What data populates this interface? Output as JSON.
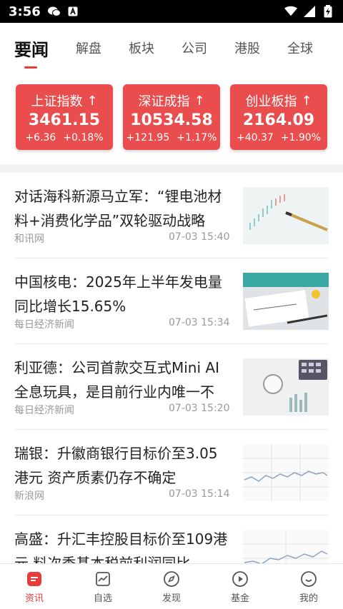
{
  "status": {
    "time": "3:56"
  },
  "tabs": [
    {
      "label": "要闻",
      "active": true
    },
    {
      "label": "解盘"
    },
    {
      "label": "板块"
    },
    {
      "label": "公司"
    },
    {
      "label": "港股"
    },
    {
      "label": "全球"
    }
  ],
  "indices": [
    {
      "name": "上证指数",
      "value": "3461.15",
      "change": "+6.36",
      "pct": "+0.18%"
    },
    {
      "name": "深证成指",
      "value": "10534.58",
      "change": "+121.95",
      "pct": "+1.17%"
    },
    {
      "name": "创业板指",
      "value": "2164.09",
      "change": "+40.37",
      "pct": "+1.90%"
    }
  ],
  "news": [
    {
      "title": "对话海科新源马立军：“锂电池材料+消费化学品”双轮驱动战略",
      "source": "和讯网",
      "time": "07-03 15:40"
    },
    {
      "title": "中国核电：2025年上半年发电量同比增长15.65%",
      "source": "每日经济新闻",
      "time": "07-03 15:34"
    },
    {
      "title": "利亚德：公司首款交互式Mini AI全息玩具，是目前行业内唯一不",
      "source": "每日经济新闻",
      "time": "07-03 15:20"
    },
    {
      "title": "瑞银：升徽商银行目标价至3.05港元 资产质素仍存不确定",
      "source": "新浪网",
      "time": "07-03 15:14"
    },
    {
      "title": "高盛：升汇丰控股目标价至109港元 料次季基本税前利润同比",
      "source": "",
      "time": ""
    }
  ],
  "nav": [
    {
      "label": "资讯",
      "icon": "news-icon",
      "active": true
    },
    {
      "label": "自选",
      "icon": "chart-icon"
    },
    {
      "label": "发现",
      "icon": "compass-icon"
    },
    {
      "label": "基金",
      "icon": "play-icon"
    },
    {
      "label": "我的",
      "icon": "smile-icon"
    }
  ],
  "colors": {
    "accent": "#e63c3c",
    "card": "#ea4d4d"
  }
}
